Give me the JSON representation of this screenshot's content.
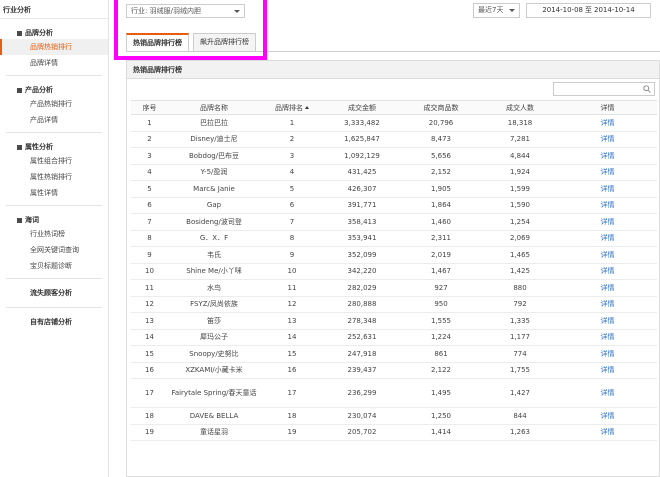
{
  "sidebar": {
    "top": "行业分析",
    "groups": [
      {
        "title": "品牌分析",
        "items": [
          "品牌热销排行",
          "品牌详情"
        ]
      },
      {
        "title": "产品分析",
        "items": [
          "产品热销排行",
          "产品详情"
        ]
      },
      {
        "title": "属性分析",
        "items": [
          "属性组合排行",
          "属性热销排行",
          "属性详情"
        ]
      },
      {
        "title": "海词",
        "items": [
          "行业热词榜",
          "全网关键词查询",
          "宝贝标题诊断"
        ]
      }
    ],
    "extra": [
      "流失顾客分析",
      "自有店铺分析"
    ]
  },
  "topbar": {
    "industry": "行业: 羽绒服/羽绒内胆",
    "range": "最近7天",
    "date_from": "2014-10-08",
    "date_sep": "至",
    "date_to": "2014-10-14"
  },
  "tabs": [
    "热销品牌排行榜",
    "飙升品牌排行榜"
  ],
  "panel": {
    "title": "热销品牌排行榜",
    "search_placeholder": ""
  },
  "table": {
    "headers": [
      "序号",
      "品牌名称",
      "品牌排名",
      "成交金额",
      "成交商品数",
      "成交人数",
      "详情"
    ],
    "detail_label": "详情",
    "rows": [
      [
        "1",
        "巴拉巴拉",
        "1",
        "3,333,482",
        "20,796",
        "18,318"
      ],
      [
        "2",
        "Disney/迪士尼",
        "2",
        "1,625,847",
        "8,473",
        "7,281"
      ],
      [
        "3",
        "Bobdog/巴布豆",
        "3",
        "1,092,129",
        "5,656",
        "4,844"
      ],
      [
        "4",
        "Y-5/盈润",
        "4",
        "431,425",
        "2,152",
        "1,924"
      ],
      [
        "5",
        "Marc& Janie",
        "5",
        "426,307",
        "1,905",
        "1,599"
      ],
      [
        "6",
        "Gap",
        "6",
        "391,771",
        "1,864",
        "1,590"
      ],
      [
        "7",
        "Bosideng/波司登",
        "7",
        "358,413",
        "1,460",
        "1,254"
      ],
      [
        "8",
        "G．X．F",
        "8",
        "353,941",
        "2,311",
        "2,069"
      ],
      [
        "9",
        "韦氏",
        "9",
        "352,099",
        "2,019",
        "1,465"
      ],
      [
        "10",
        "Shine Me/小丫咪",
        "10",
        "342,220",
        "1,467",
        "1,425"
      ],
      [
        "11",
        "水鸟",
        "11",
        "282,029",
        "927",
        "880"
      ],
      [
        "12",
        "FSYZ/凤尚依族",
        "12",
        "280,888",
        "950",
        "792"
      ],
      [
        "13",
        "笛莎",
        "13",
        "278,348",
        "1,555",
        "1,335"
      ],
      [
        "14",
        "犀玛公子",
        "14",
        "252,631",
        "1,224",
        "1,177"
      ],
      [
        "15",
        "Snoopy/史努比",
        "15",
        "247,918",
        "861",
        "774"
      ],
      [
        "16",
        "XZKAMI/小藏卡米",
        "16",
        "239,437",
        "2,122",
        "1,755"
      ],
      [
        "17",
        "Fairytale Spring/春天童话",
        "17",
        "236,299",
        "1,495",
        "1,427"
      ],
      [
        "18",
        "DAVE& BELLA",
        "18",
        "230,074",
        "1,250",
        "844"
      ],
      [
        "19",
        "童话星羽",
        "19",
        "205,702",
        "1,414",
        "1,263"
      ]
    ]
  },
  "colors": {
    "accent": "#e85c0d",
    "link": "#2a6dc4",
    "highlight": "#ff00ff"
  }
}
